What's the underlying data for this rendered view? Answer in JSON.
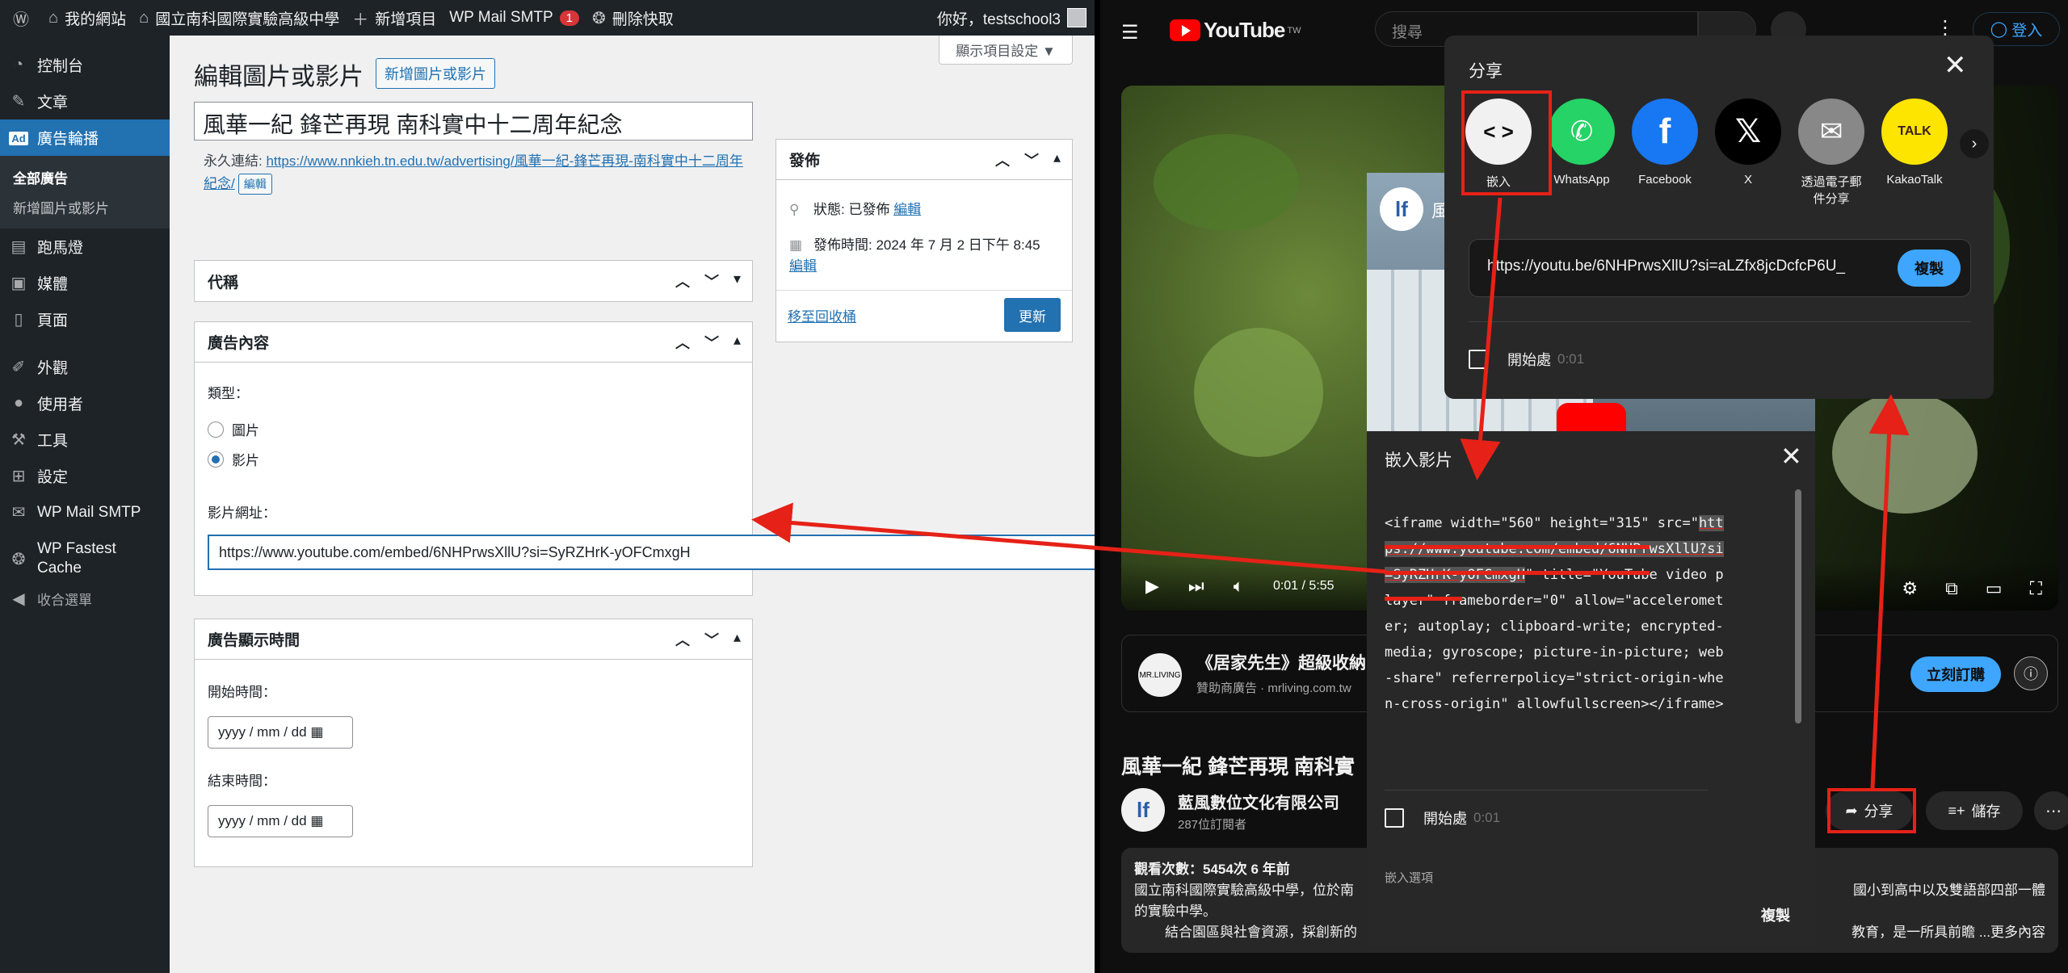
{
  "wp": {
    "adminbar": {
      "site": "我的網站",
      "school": "國立南科國際實驗高級中學",
      "new_item": "新增項目",
      "smtp": "WP Mail SMTP",
      "smtp_badge": "1",
      "cache": "刪除快取",
      "greeting": "你好，testschool3"
    },
    "sidebar": {
      "items": [
        {
          "label": "控制台",
          "icon": "dashboard-icon"
        },
        {
          "label": "文章",
          "icon": "pin-icon"
        },
        {
          "label": "廣告輪播",
          "icon": "ad-icon"
        },
        {
          "label": "跑馬燈",
          "icon": "marquee-icon"
        },
        {
          "label": "媒體",
          "icon": "media-icon"
        },
        {
          "label": "頁面",
          "icon": "page-icon"
        },
        {
          "label": "外觀",
          "icon": "brush-icon"
        },
        {
          "label": "使用者",
          "icon": "user-icon"
        },
        {
          "label": "工具",
          "icon": "wrench-icon"
        },
        {
          "label": "設定",
          "icon": "settings-icon"
        },
        {
          "label": "WP Mail SMTP",
          "icon": "mail-icon"
        },
        {
          "label": "WP Fastest Cache",
          "icon": "cheetah-icon"
        },
        {
          "label": "收合選單",
          "icon": "collapse-icon"
        }
      ],
      "sub": [
        "全部廣告",
        "新增圖片或影片"
      ],
      "ad_badge": "Ad"
    },
    "screen_options": "顯示項目設定 ▼",
    "page_title": "編輯圖片或影片",
    "add_new": "新增圖片或影片",
    "post_title": "風華一紀 鋒芒再現 南科實中十二周年紀念",
    "permalink_label": "永久連結:",
    "permalink_url": "https://www.nnkieh.tn.edu.tw/advertising/風華一紀-鋒芒再現-南科實中十二周年紀念/",
    "edit_btn": "編輯",
    "box_code": "代稱",
    "box_content": "廣告內容",
    "type_label": "類型：",
    "radio_image": "圖片",
    "radio_video": "影片",
    "video_url_label": "影片網址：",
    "video_url": "https://www.youtube.com/embed/6NHPrwsXllU?si=SyRZHrK-yOFCmxgH",
    "box_time": "廣告顯示時間",
    "start_label": "開始時間：",
    "end_label": "結束時間：",
    "date_placeholder": "yyyy / mm / dd",
    "publish": {
      "title": "發佈",
      "status_label": "狀態: 已發佈",
      "status_edit": "編輯",
      "time_label": "發佈時間: 2024 年 7 月 2 日下午 8:45",
      "time_edit": "編輯",
      "trash": "移至回收桶",
      "update": "更新"
    }
  },
  "yt": {
    "logo": "YouTube",
    "logo_tw": "TW",
    "search_placeholder": "搜尋",
    "signin": "登入",
    "time": "0:01 / 5:55",
    "ad_title": "《居家先生》超級收納",
    "ad_sub": "贊助商廣告 · mrliving.com.tw",
    "ad_logo": "MR.LIVING",
    "ad_subscribe": "立刻訂購",
    "video_title": "風華一紀 鋒芒再現 南科實",
    "channel_name": "藍風數位文化有限公司",
    "channel_avatar": "lf",
    "subs": "287位訂閱者",
    "share_btn": "分享",
    "save_btn": "儲存",
    "desc_views": "觀看次數：5454次 6 年前",
    "desc_line1": "國立南科國際實驗高級中學，位於南",
    "desc_line1b": "國小到高中以及雙語部四部一體",
    "desc_line2": "的實驗中學。",
    "desc_line3": "結合園區與社會資源，採創新的",
    "desc_line3b": "教育，是一所具前瞻 ...更多內容",
    "share": {
      "title": "分享",
      "options": [
        {
          "label": "嵌入",
          "icon": "embed-icon",
          "bg": "#f1f1f1"
        },
        {
          "label": "WhatsApp",
          "icon": "whatsapp-icon",
          "bg": "#25d366"
        },
        {
          "label": "Facebook",
          "icon": "facebook-icon",
          "bg": "#1877f2"
        },
        {
          "label": "X",
          "icon": "x-icon",
          "bg": "#000000"
        },
        {
          "label": "透過電子郵件分享",
          "icon": "email-icon",
          "bg": "#888888"
        },
        {
          "label": "KakaoTalk",
          "icon": "kakaotalk-icon",
          "bg": "#fee500"
        }
      ],
      "url": "https://youtu.be/6NHPrwsXllU?si=aLZfx8jcDcfcP6U_",
      "copy": "複製",
      "start_at": "開始處",
      "start_time": "0:01"
    },
    "embed": {
      "title": "嵌入影片",
      "code_pre": "<iframe width=\"560\" height=\"315\" src=\"",
      "code_url": "https://www.youtube.com/embed/6NHPrwsXllU?si=SyRZHrK-yOFCmxgH",
      "code_post": "\" title=\"YouTube video player\" frameborder=\"0\" allow=\"accelerometer; autoplay; clipboard-write; encrypted-media; gyroscope; picture-in-picture; web-share\" referrerpolicy=\"strict-origin-when-cross-origin\" allowfullscreen></iframe>",
      "start_at": "開始處",
      "start_time": "0:01",
      "options": "嵌入選項",
      "copy": "複製",
      "thumb_title": "風"
    }
  },
  "colors": {
    "wp_blue": "#2271b1",
    "yt_red": "#ff0000",
    "annotation": "#e62117"
  }
}
